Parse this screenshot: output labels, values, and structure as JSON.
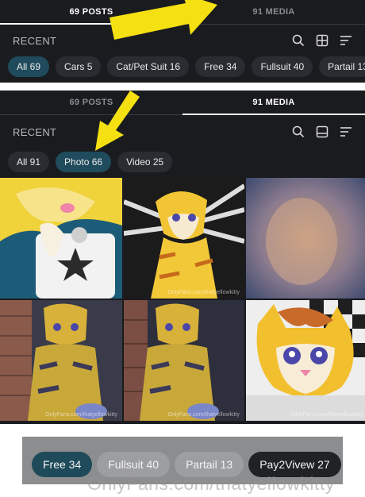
{
  "top": {
    "tabs": [
      "69 POSTS",
      "91 MEDIA"
    ],
    "active_tab": 0,
    "recent_label": "RECENT",
    "chips": [
      "All 69",
      "Cars 5",
      "Cat/Pet Suit 16",
      "Free 34",
      "Fullsuit 40",
      "Partail 13",
      "Pa"
    ]
  },
  "media": {
    "tabs": [
      "69 POSTS",
      "91 MEDIA"
    ],
    "active_tab": 1,
    "recent_label": "RECENT",
    "chips": [
      "All 91",
      "Photo 66",
      "Video 25"
    ],
    "active_chip": 1,
    "watermarks": [
      "",
      "OnlyFans.com/thatyellowkitty",
      "",
      "OnlyFans.com/thatyellowkitty",
      "OnlyFans.com/thatyellowkitty",
      "OnlyFans.com/thatyellowkitty"
    ]
  },
  "bottom": {
    "chips": [
      "Free 34",
      "Fullsuit 40",
      "Partail 13",
      "Pay2Vivew 27"
    ]
  },
  "watermark": "OnlyFans.com/thatyellowkitty",
  "colors": {
    "panel": "#1a1b1f",
    "chip": "#2a2c31",
    "chip_active": "#1f4b5c",
    "arrow": "#f5e012"
  },
  "icons": [
    "search-icon",
    "grid-icon",
    "list-icon",
    "sort-icon",
    "arrow-annotation"
  ]
}
